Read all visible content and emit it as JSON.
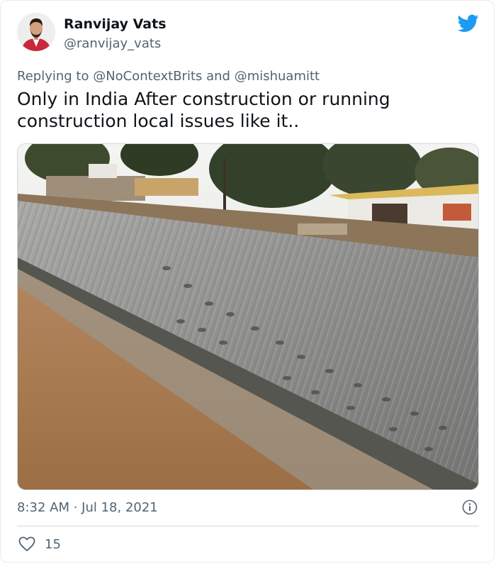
{
  "author": {
    "name": "Ranvijay Vats",
    "handle": "@ranvijay_vats"
  },
  "reply": {
    "prefix": "Replying to ",
    "mention_1": "@NoContextBrits",
    "joiner": " and ",
    "mention_2": "@mishuamitt"
  },
  "tweet": {
    "text": "Only in India After construction or running construction local issues like it.."
  },
  "meta": {
    "timestamp": "8:32 AM · Jul 18, 2021"
  },
  "engagement": {
    "likes": "15"
  },
  "icons": {
    "brand": "twitter-bird-icon",
    "info": "info-icon",
    "like": "heart-icon"
  },
  "colors": {
    "brand_blue": "#1d9bf0",
    "secondary_text": "#536471",
    "primary_text": "#0f1419"
  }
}
